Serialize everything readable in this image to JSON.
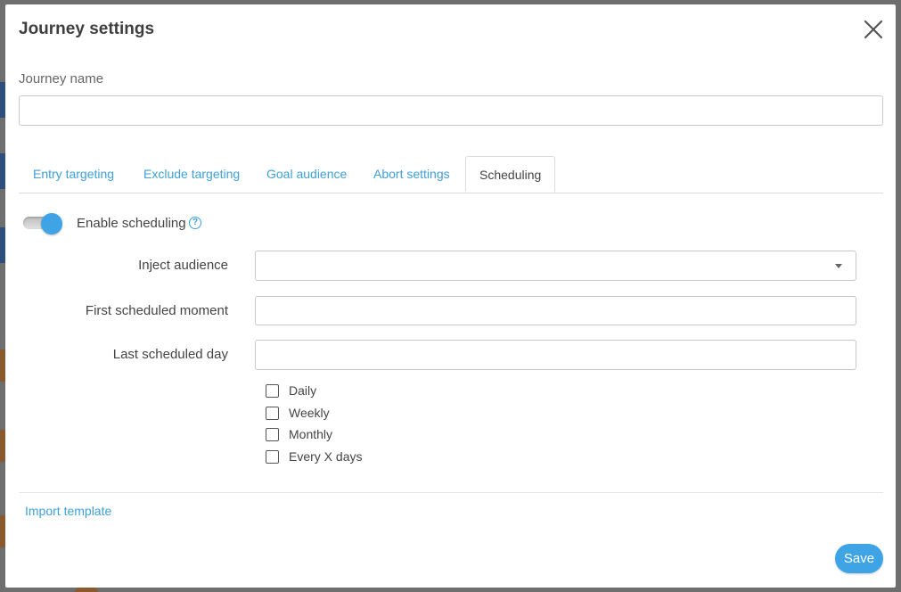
{
  "dialog": {
    "title": "Journey settings"
  },
  "journey_name": {
    "label": "Journey name",
    "value": "",
    "placeholder": ""
  },
  "tabs": [
    {
      "label": "Entry targeting",
      "active": false
    },
    {
      "label": "Exclude targeting",
      "active": false
    },
    {
      "label": "Goal audience",
      "active": false
    },
    {
      "label": "Abort settings",
      "active": false
    },
    {
      "label": "Scheduling",
      "active": true
    }
  ],
  "scheduling": {
    "enable_label": "Enable scheduling",
    "enabled": true,
    "help_glyph": "?",
    "inject_audience": {
      "label": "Inject audience",
      "value": ""
    },
    "first_scheduled_moment": {
      "label": "First scheduled moment",
      "value": ""
    },
    "last_scheduled_day": {
      "label": "Last scheduled day",
      "value": ""
    },
    "options": [
      {
        "label": "Daily",
        "checked": false
      },
      {
        "label": "Weekly",
        "checked": false
      },
      {
        "label": "Monthly",
        "checked": false
      },
      {
        "label": "Every X days",
        "checked": false
      }
    ]
  },
  "footer": {
    "import_label": "Import template",
    "save_label": "Save"
  },
  "colors": {
    "accent": "#3ea4e6",
    "link": "#3ea0d8",
    "overlay": "#6e6e6e"
  }
}
